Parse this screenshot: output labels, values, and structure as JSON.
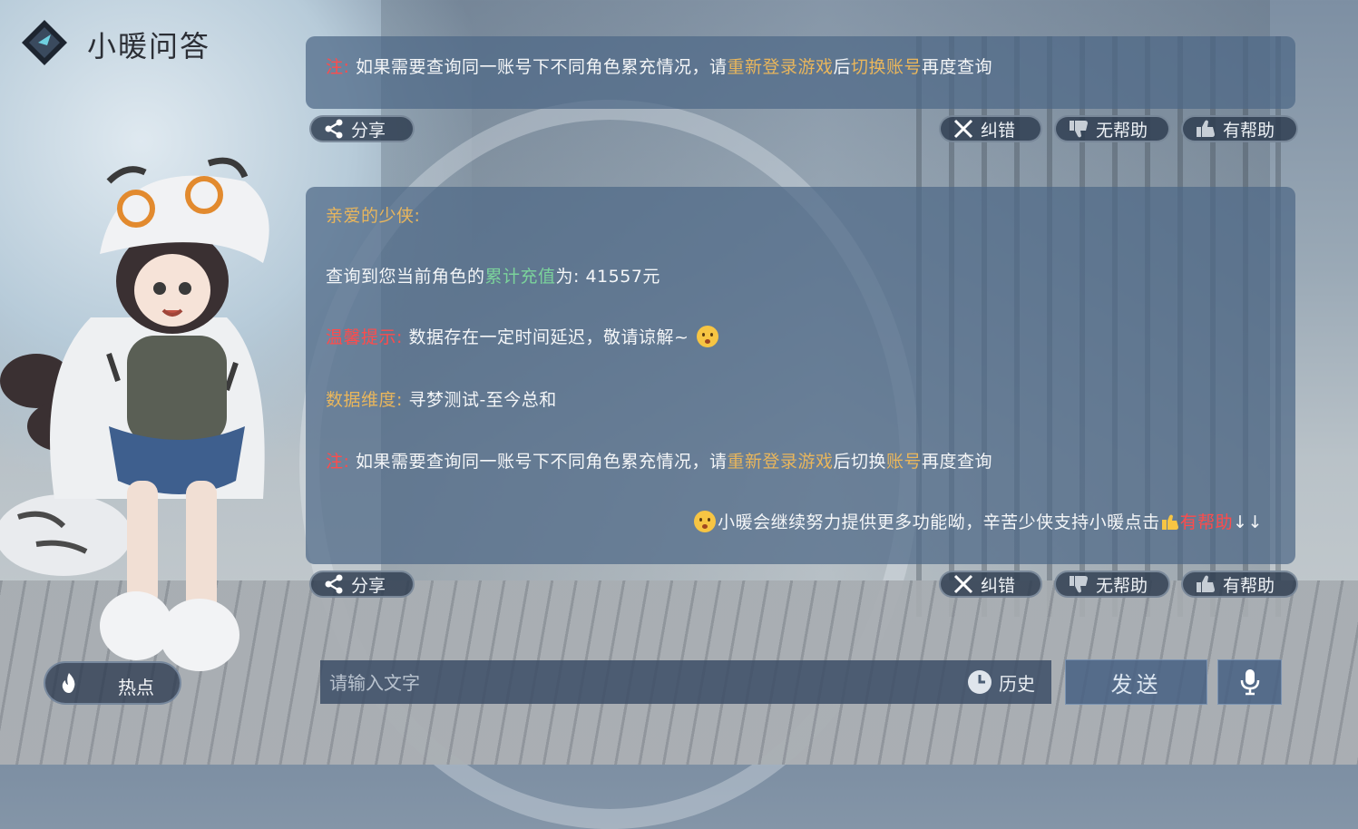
{
  "header": {
    "title": "小暖问答",
    "logo_icon": "diamond-logo-icon"
  },
  "panel1": {
    "note": {
      "prefix": "注:",
      "t1": "如果需要查询同一账号下不同角色累充情况，请",
      "h1": "重新登录游戏",
      "t2": "后",
      "h2": "切换账号",
      "t3": "再度查询"
    },
    "actions": {
      "share": "分享",
      "correct": "纠错",
      "unhelpful": "无帮助",
      "helpful": "有帮助"
    }
  },
  "panel2": {
    "greeting": "亲爱的少侠:",
    "recharge": {
      "t1": "查询到您当前角色的",
      "highlight": "累计充值",
      "t2": "为: 41557元"
    },
    "tip": {
      "label": "温馨提示:",
      "text": "数据存在一定时间延迟，敬请谅解~"
    },
    "dimension": {
      "label": "数据维度:",
      "text": "寻梦测试-至今总和"
    },
    "note": {
      "prefix": "注:",
      "t1": "如果需要查询同一账号下不同角色累充情况，请",
      "h1": "重新登录游戏",
      "t2": "后切换",
      "h2": "账号",
      "t3": "再度查询"
    },
    "closing": {
      "text": "小暖会继续努力提供更多功能呦，辛苦少侠支持小暖点击",
      "highlight": "有帮助",
      "arrows": "↓↓"
    },
    "actions": {
      "share": "分享",
      "correct": "纠错",
      "unhelpful": "无帮助",
      "helpful": "有帮助"
    }
  },
  "bottom": {
    "hot_label": "热点",
    "input_placeholder": "请输入文字",
    "history_label": "历史",
    "send_label": "发送",
    "mic_icon": "microphone-icon"
  },
  "colors": {
    "red": "#ff4b4b",
    "gold": "#e9b65c",
    "green": "#7bd39b",
    "panel": "#4e6887"
  }
}
